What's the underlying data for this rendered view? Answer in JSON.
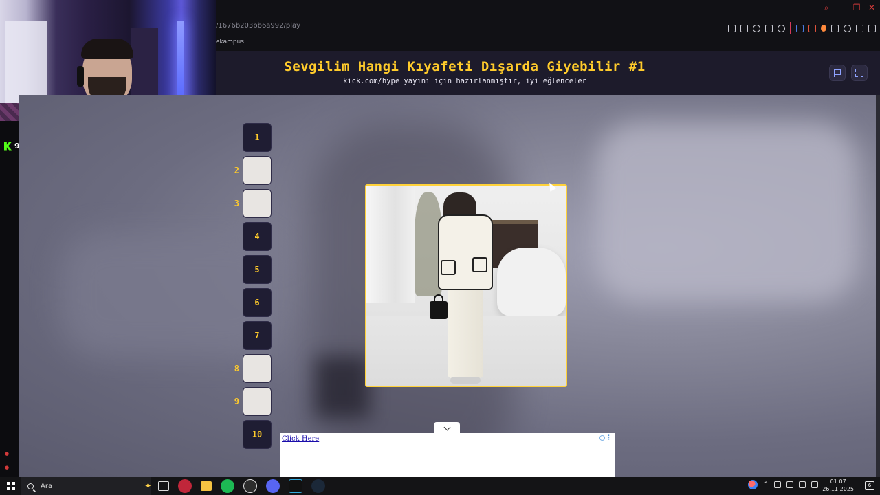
{
  "browser": {
    "address_fragment": "/1676b203bb6a992/play",
    "bookmark_label": "ekampüs",
    "window_controls": [
      "search-icon",
      "minimize-icon",
      "restore-icon",
      "close-icon"
    ],
    "toolbar_icons": [
      "pin-icon",
      "screenshot-icon",
      "shield-icon",
      "play-icon",
      "heart-icon",
      "translate-icon",
      "extension-icon",
      "flame-icon",
      "puzzle-icon",
      "account-icon",
      "download-icon",
      "menu-icon"
    ]
  },
  "stream": {
    "viewer_count": "9",
    "kick_brand_color": "#53fc18"
  },
  "header": {
    "title": "Sevgilim Hangi Kıyafeti Dışarda Giyebilir #1",
    "subtitle": "kick.com/hype yayını için hazırlanmıştır, iyi eğlenceler",
    "title_color": "#ffcb2b"
  },
  "ranking": {
    "items": [
      {
        "label": "1",
        "type": "number"
      },
      {
        "label": "2",
        "type": "thumb"
      },
      {
        "label": "3",
        "type": "thumb"
      },
      {
        "label": "4",
        "type": "number"
      },
      {
        "label": "5",
        "type": "number"
      },
      {
        "label": "6",
        "type": "number"
      },
      {
        "label": "7",
        "type": "number"
      },
      {
        "label": "8",
        "type": "thumb"
      },
      {
        "label": "9",
        "type": "thumb"
      },
      {
        "label": "10",
        "type": "number"
      }
    ]
  },
  "ad": {
    "link_text": "Click Here"
  },
  "taskbar": {
    "search_placeholder": "Ara",
    "time": "01:07",
    "date": "26.11.2025",
    "notification_count": "6"
  },
  "colors": {
    "accent": "#ffcb2b",
    "header_bg": "#1d1b2b",
    "frame_border": "#ffd23a"
  }
}
